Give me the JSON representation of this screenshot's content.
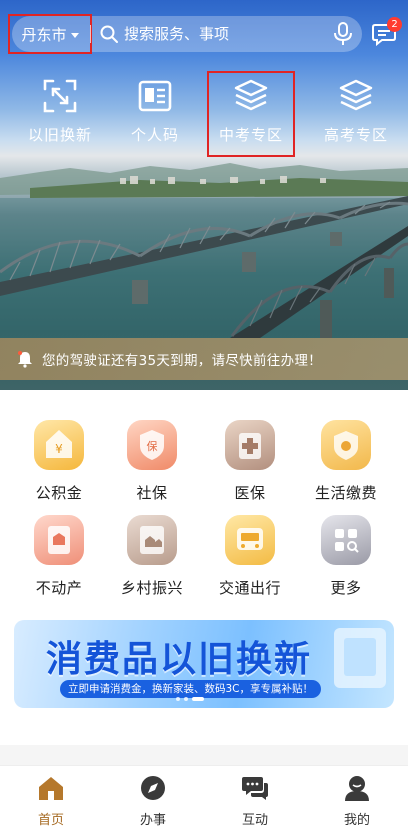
{
  "header": {
    "city": "丹东市",
    "search_placeholder": "搜索服务、事项",
    "message_badge": "2"
  },
  "quick_actions": [
    {
      "label": "以旧换新",
      "icon": "scan-frame-icon"
    },
    {
      "label": "个人码",
      "icon": "personal-code-icon"
    },
    {
      "label": "中考专区",
      "icon": "stack-layers-icon"
    },
    {
      "label": "高考专区",
      "icon": "stack-layers-icon"
    }
  ],
  "notice": {
    "text": "您的驾驶证还有35天到期，请尽快前往办理！",
    "icon": "bell-icon"
  },
  "services": [
    {
      "label": "公积金",
      "icon": "housing-fund-icon",
      "color": "#f5b73c"
    },
    {
      "label": "社保",
      "icon": "social-security-icon",
      "color": "#f08a68"
    },
    {
      "label": "医保",
      "icon": "medical-insurance-icon",
      "color": "#b28f7e"
    },
    {
      "label": "生活缴费",
      "icon": "bill-payment-icon",
      "color": "#f2b84b"
    },
    {
      "label": "不动产",
      "icon": "real-estate-icon",
      "color": "#ef8f78"
    },
    {
      "label": "乡村振兴",
      "icon": "rural-revitalization-icon",
      "color": "#b89c8c"
    },
    {
      "label": "交通出行",
      "icon": "transport-icon",
      "color": "#f3bb44"
    },
    {
      "label": "更多",
      "icon": "more-grid-icon",
      "color": "#9a9aa6"
    }
  ],
  "banner": {
    "title": "消费品以旧换新",
    "subtitle": "立即申请消费金，换新家装、数码3C，享专属补贴！"
  },
  "tabs": [
    {
      "label": "首页",
      "icon": "home-icon",
      "active": true,
      "color": "#a66a22"
    },
    {
      "label": "办事",
      "icon": "compass-icon",
      "active": false
    },
    {
      "label": "互动",
      "icon": "chat-icon",
      "active": false
    },
    {
      "label": "我的",
      "icon": "profile-icon",
      "active": false
    }
  ]
}
